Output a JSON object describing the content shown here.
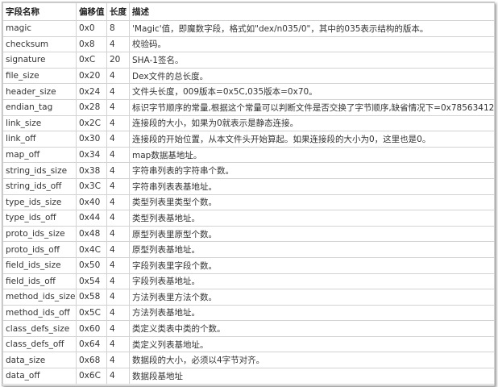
{
  "headers": [
    "字段名称",
    "偏移值",
    "长度",
    "描述"
  ],
  "rows": [
    [
      "magic",
      "0x0",
      "8",
      "'Magic'值，即魔数字段，格式如\"dex/n035/0\"，其中的035表示结构的版本。"
    ],
    [
      "checksum",
      "0x8",
      "4",
      "校验码。"
    ],
    [
      "signature",
      "0xC",
      "20",
      "SHA-1签名。"
    ],
    [
      "file_size",
      "0x20",
      "4",
      "Dex文件的总长度。"
    ],
    [
      "header_size",
      "0x24",
      "4",
      "文件头长度，009版本=0x5C,035版本=0x70。"
    ],
    [
      "endian_tag",
      "0x28",
      "4",
      "标识字节顺序的常量,根据这个常量可以判断文件是否交换了字节顺序,缺省情况下=0x78563412。"
    ],
    [
      "link_size",
      "0x2C",
      "4",
      "连接段的大小，如果为0就表示是静态连接。"
    ],
    [
      "link_off",
      "0x30",
      "4",
      "连接段的开始位置，从本文件头开始算起。如果连接段的大小为0，这里也是0。"
    ],
    [
      "map_off",
      "0x34",
      "4",
      "map数据基地址。"
    ],
    [
      "string_ids_size",
      "0x38",
      "4",
      "字符串列表的字符串个数。"
    ],
    [
      "string_ids_off",
      "0x3C",
      "4",
      "字符串列表表基地址。"
    ],
    [
      "type_ids_size",
      "0x40",
      "4",
      "类型列表里类型个数。"
    ],
    [
      "type_ids_off",
      "0x44",
      "4",
      "类型列表基地址。"
    ],
    [
      "proto_ids_size",
      "0x48",
      "4",
      "原型列表里原型个数。"
    ],
    [
      "proto_ids_off",
      "0x4C",
      "4",
      "原型列表基地址。"
    ],
    [
      "field_ids_size",
      "0x50",
      "4",
      "字段列表里字段个数。"
    ],
    [
      "field_ids_off",
      "0x54",
      "4",
      "字段列表基地址。"
    ],
    [
      "method_ids_size",
      "0x58",
      "4",
      "方法列表里方法个数。"
    ],
    [
      "method_ids_off",
      "0x5C",
      "4",
      "方法列表基地址。"
    ],
    [
      "class_defs_size",
      "0x60",
      "4",
      "类定义类表中类的个数。"
    ],
    [
      "class_defs_off",
      "0x64",
      "4",
      "类定义列表基地址。"
    ],
    [
      "data_size",
      "0x68",
      "4",
      "数据段的大小，必须以4字节对齐。"
    ],
    [
      "data_off",
      "0x6C",
      "4",
      "数据段基地址"
    ]
  ]
}
